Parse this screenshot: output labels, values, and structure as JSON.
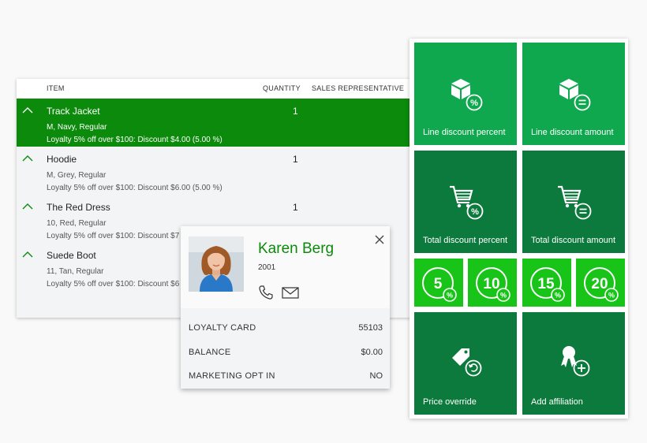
{
  "grid": {
    "headers": {
      "item": "ITEM",
      "quantity": "QUANTITY",
      "sales_rep": "SALES REPRESENTATIVE"
    },
    "rows": [
      {
        "name": "Track Jacket",
        "qty": "1",
        "desc": "M, Navy, Regular",
        "discount": "Loyalty 5% off over $100: Discount $4.00 (5.00 %)"
      },
      {
        "name": "Hoodie",
        "qty": "1",
        "desc": "M, Grey, Regular",
        "discount": "Loyalty 5% off over $100: Discount $6.00 (5.00 %)"
      },
      {
        "name": "The Red Dress",
        "qty": "1",
        "desc": "10, Red, Regular",
        "discount": "Loyalty 5% off over $100: Discount $7"
      },
      {
        "name": "Suede Boot",
        "qty": "",
        "desc": "11, Tan, Regular",
        "discount": "Loyalty 5% off over $100: Discount $6"
      }
    ]
  },
  "customer": {
    "name": "Karen Berg",
    "id": "2001",
    "rows": [
      {
        "label": "LOYALTY CARD",
        "value": "55103"
      },
      {
        "label": "BALANCE",
        "value": "$0.00"
      },
      {
        "label": "MARKETING OPT IN",
        "value": "NO"
      }
    ]
  },
  "panel": {
    "line_discount_percent": "Line discount percent",
    "line_discount_amount": "Line discount amount",
    "total_discount_percent": "Total discount percent",
    "total_discount_amount": "Total discount amount",
    "quick_percents": [
      "5",
      "10",
      "15",
      "20"
    ],
    "price_override": "Price override",
    "add_affiliation": "Add affiliation"
  },
  "colors": {
    "accent": "#0b8a0b",
    "tile_light": "#0fa84f",
    "tile_dark": "#0c7a3c",
    "tile_bright": "#17c417"
  },
  "icons": [
    "chevron-up-icon",
    "phone-icon",
    "mail-icon",
    "close-icon",
    "box-percent-icon",
    "box-equals-icon",
    "cart-percent-icon",
    "cart-equals-icon",
    "percent-badge-icon",
    "tag-reset-icon",
    "award-add-icon"
  ]
}
